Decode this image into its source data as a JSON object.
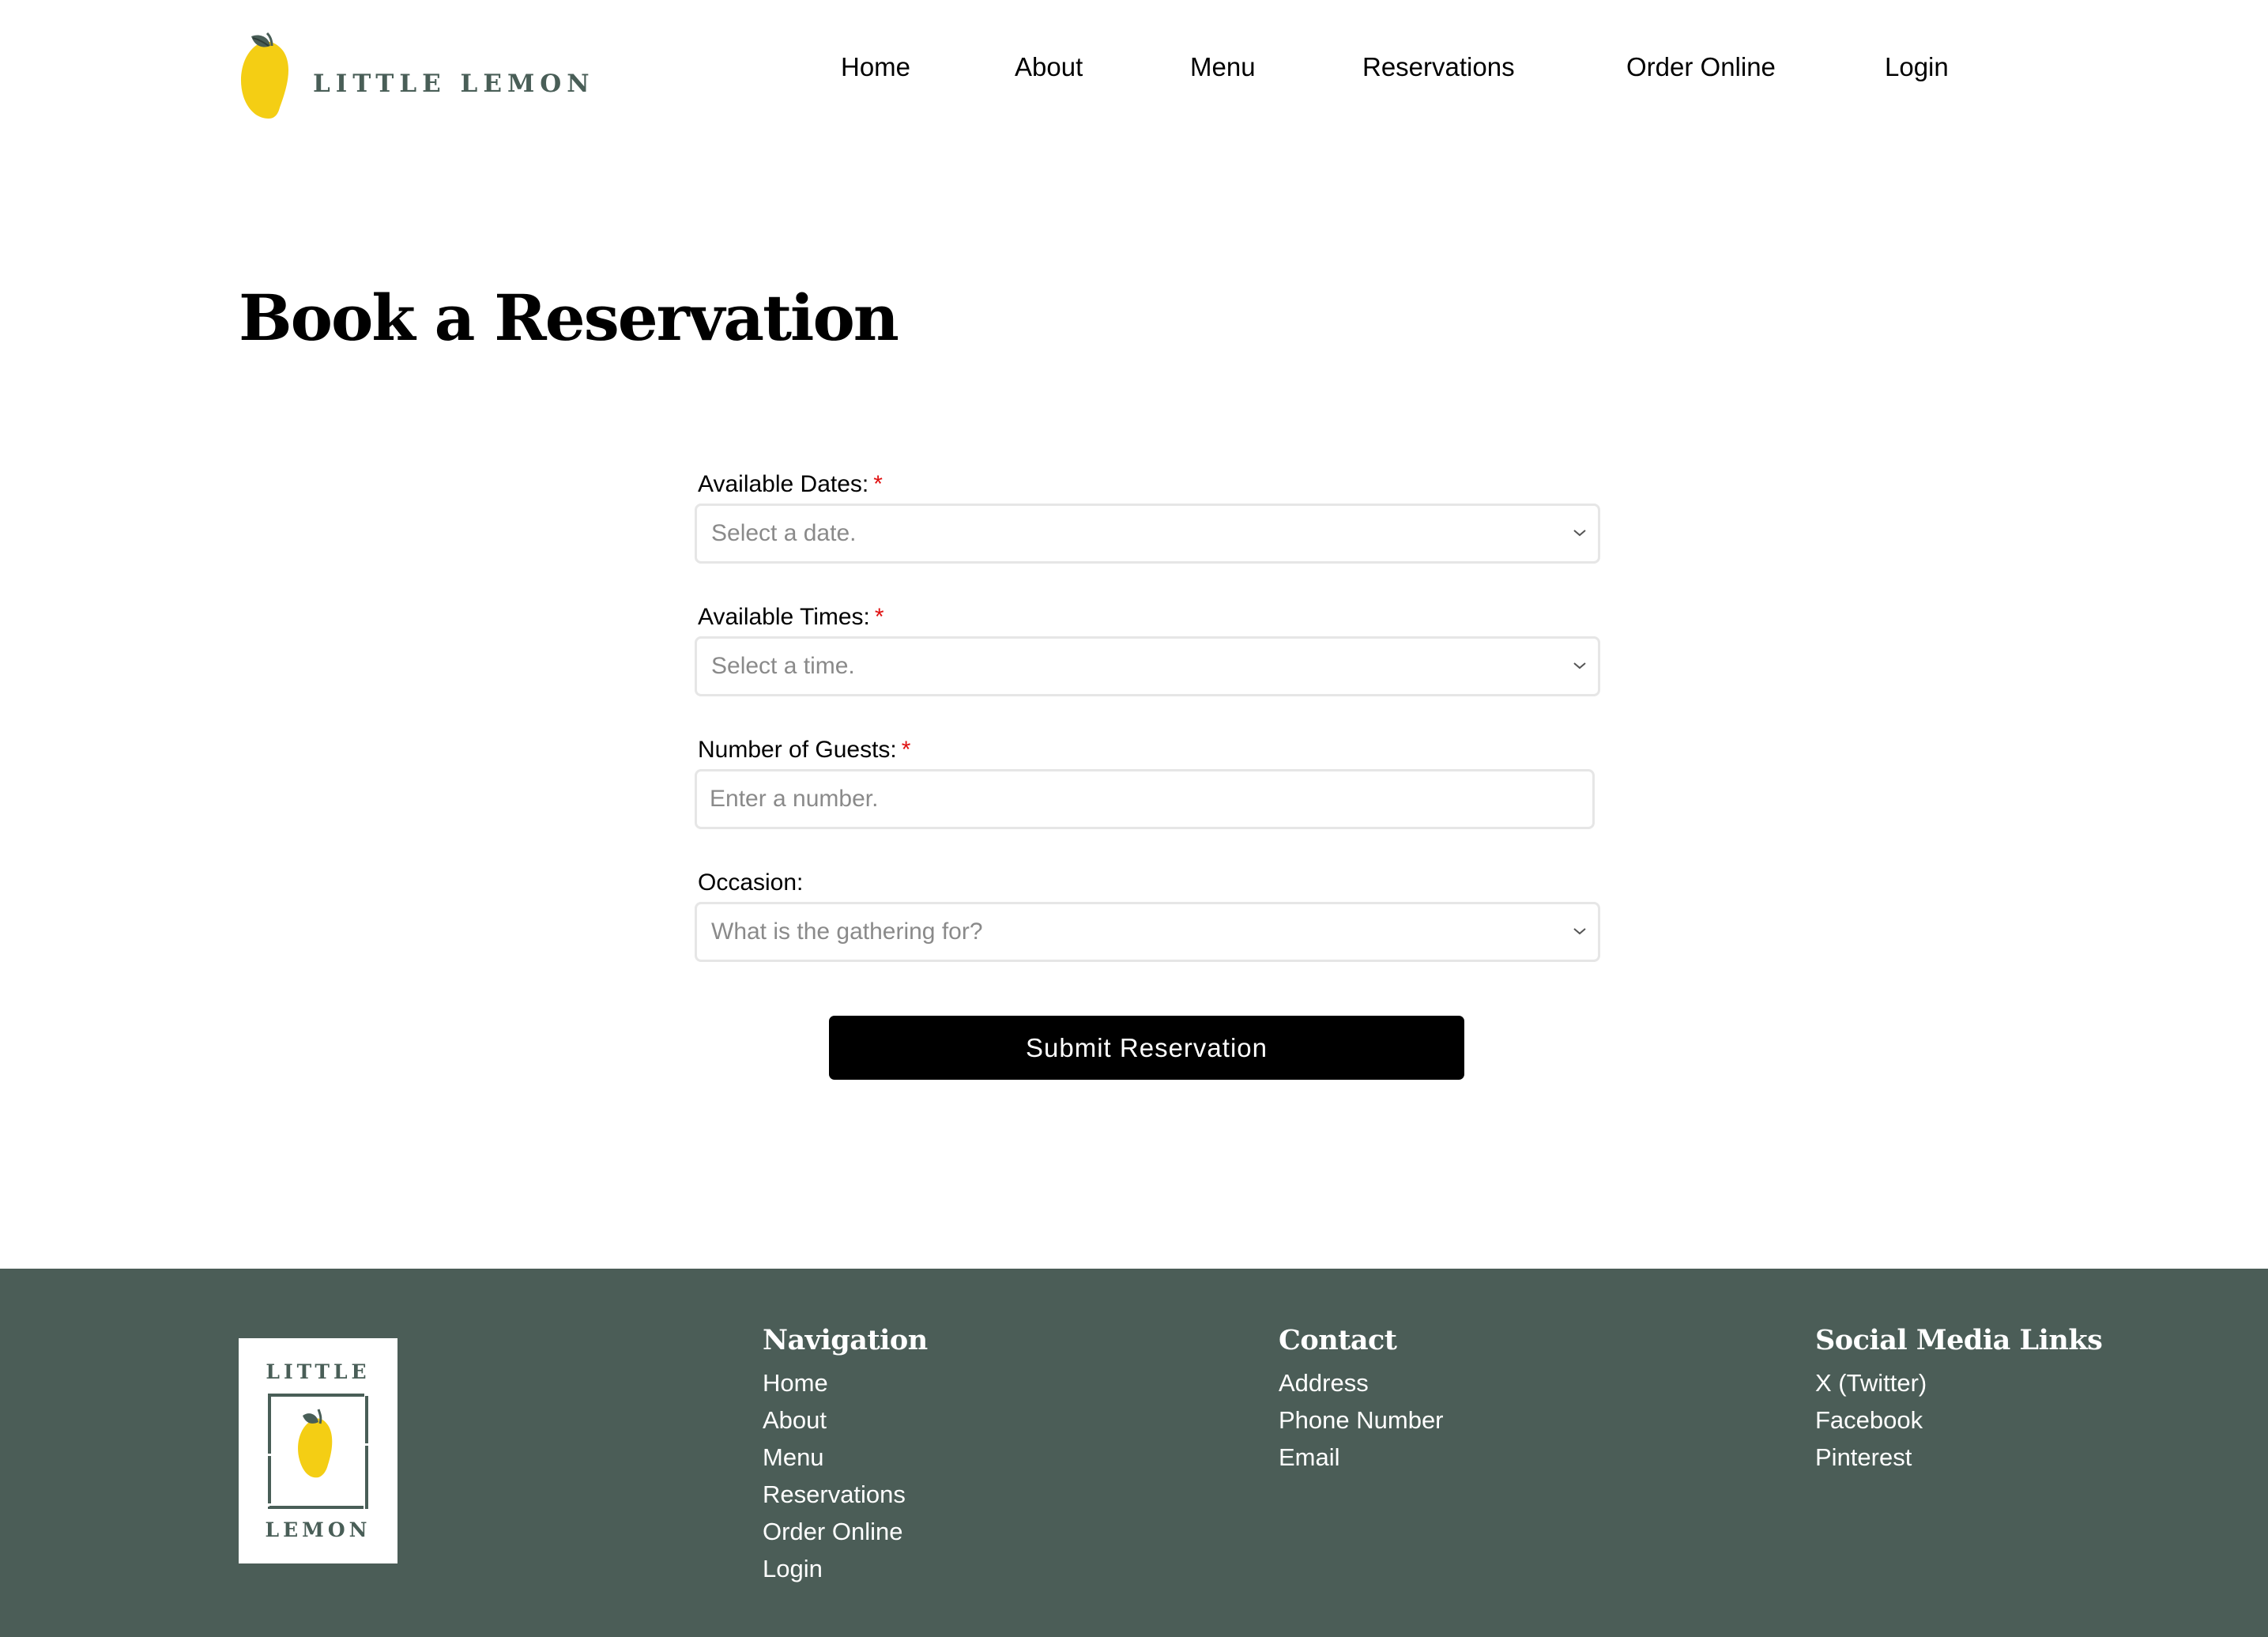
{
  "header": {
    "logo_text": "LITTLE LEMON",
    "nav": [
      "Home",
      "About",
      "Menu",
      "Reservations",
      "Order Online",
      "Login"
    ]
  },
  "page": {
    "title": "Book a Reservation"
  },
  "form": {
    "required_marker": "*",
    "date": {
      "label": "Available Dates:",
      "placeholder": "Select a date."
    },
    "time": {
      "label": "Available Times:",
      "placeholder": "Select a time."
    },
    "guests": {
      "label": "Number of Guests:",
      "placeholder": "Enter a number."
    },
    "occasion": {
      "label": "Occasion:",
      "placeholder": "What is the gathering for?"
    },
    "submit_label": "Submit Reservation"
  },
  "footer": {
    "logo_top": "LITTLE",
    "logo_bottom": "LEMON",
    "navigation": {
      "title": "Navigation",
      "links": [
        "Home",
        "About",
        "Menu",
        "Reservations",
        "Order Online",
        "Login"
      ]
    },
    "contact": {
      "title": "Contact",
      "links": [
        "Address",
        "Phone Number",
        "Email"
      ]
    },
    "social": {
      "title": "Social Media Links",
      "links": [
        "X (Twitter)",
        "Facebook",
        "Pinterest"
      ]
    }
  },
  "colors": {
    "brand_green": "#495e57",
    "footer_bg": "#4b5d57",
    "lemon_yellow": "#f4ce14",
    "required_red": "#e01010",
    "button_bg": "#000000"
  }
}
